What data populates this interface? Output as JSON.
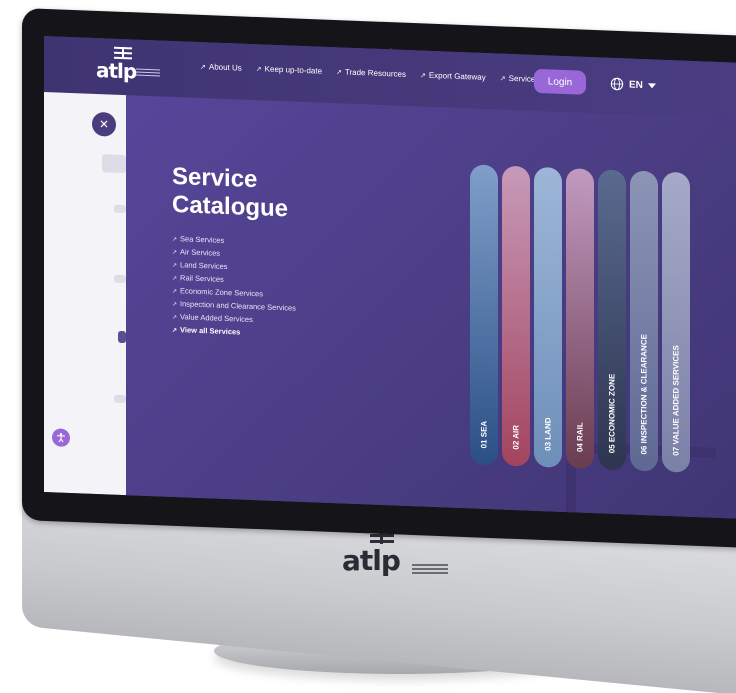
{
  "nav": {
    "menu": [
      {
        "label": "About Us"
      },
      {
        "label": "Keep up-to-date"
      },
      {
        "label": "Trade Resources"
      },
      {
        "label": "Export Gateway"
      },
      {
        "label": "Service Catalogue"
      }
    ],
    "login_label": "Login",
    "language": "EN"
  },
  "logo": {
    "word": "atlp"
  },
  "catalogue": {
    "title_line1": "Service",
    "title_line2": "Catalogue",
    "links": [
      "Sea Services",
      "Air Services",
      "Land Services",
      "Rail Services",
      "Economic Zone Services",
      "Inspection and Clearance Services",
      "Value Added Services",
      "View all Services"
    ]
  },
  "strips": [
    {
      "label": "01  SEA",
      "color1": "#7f9fc9",
      "color2": "#2b4f86"
    },
    {
      "label": "02  AIR",
      "color1": "#c79ab9",
      "color2": "#a3445e"
    },
    {
      "label": "03  LAND",
      "color1": "#9db6d8",
      "color2": "#6e8fb9"
    },
    {
      "label": "04  RAIL",
      "color1": "#c29ac1",
      "color2": "#6a3c51"
    },
    {
      "label": "05  ECONOMIC ZONE",
      "color1": "#5a6a8f",
      "color2": "#2d3550"
    },
    {
      "label": "06  INSPECTION & CLEARANCE",
      "color1": "#8c95b6",
      "color2": "#5f6894"
    },
    {
      "label": "07  VALUE ADDED SERVICES",
      "color1": "#a6aac8",
      "color2": "#7b80a7"
    }
  ],
  "colors": {
    "brand": "#4a3d7e",
    "accent": "#9a67d9"
  },
  "icons": {
    "close": "close-icon",
    "globe": "globe-icon",
    "accessibility": "accessibility-icon",
    "caret": "chevron-down-icon"
  }
}
